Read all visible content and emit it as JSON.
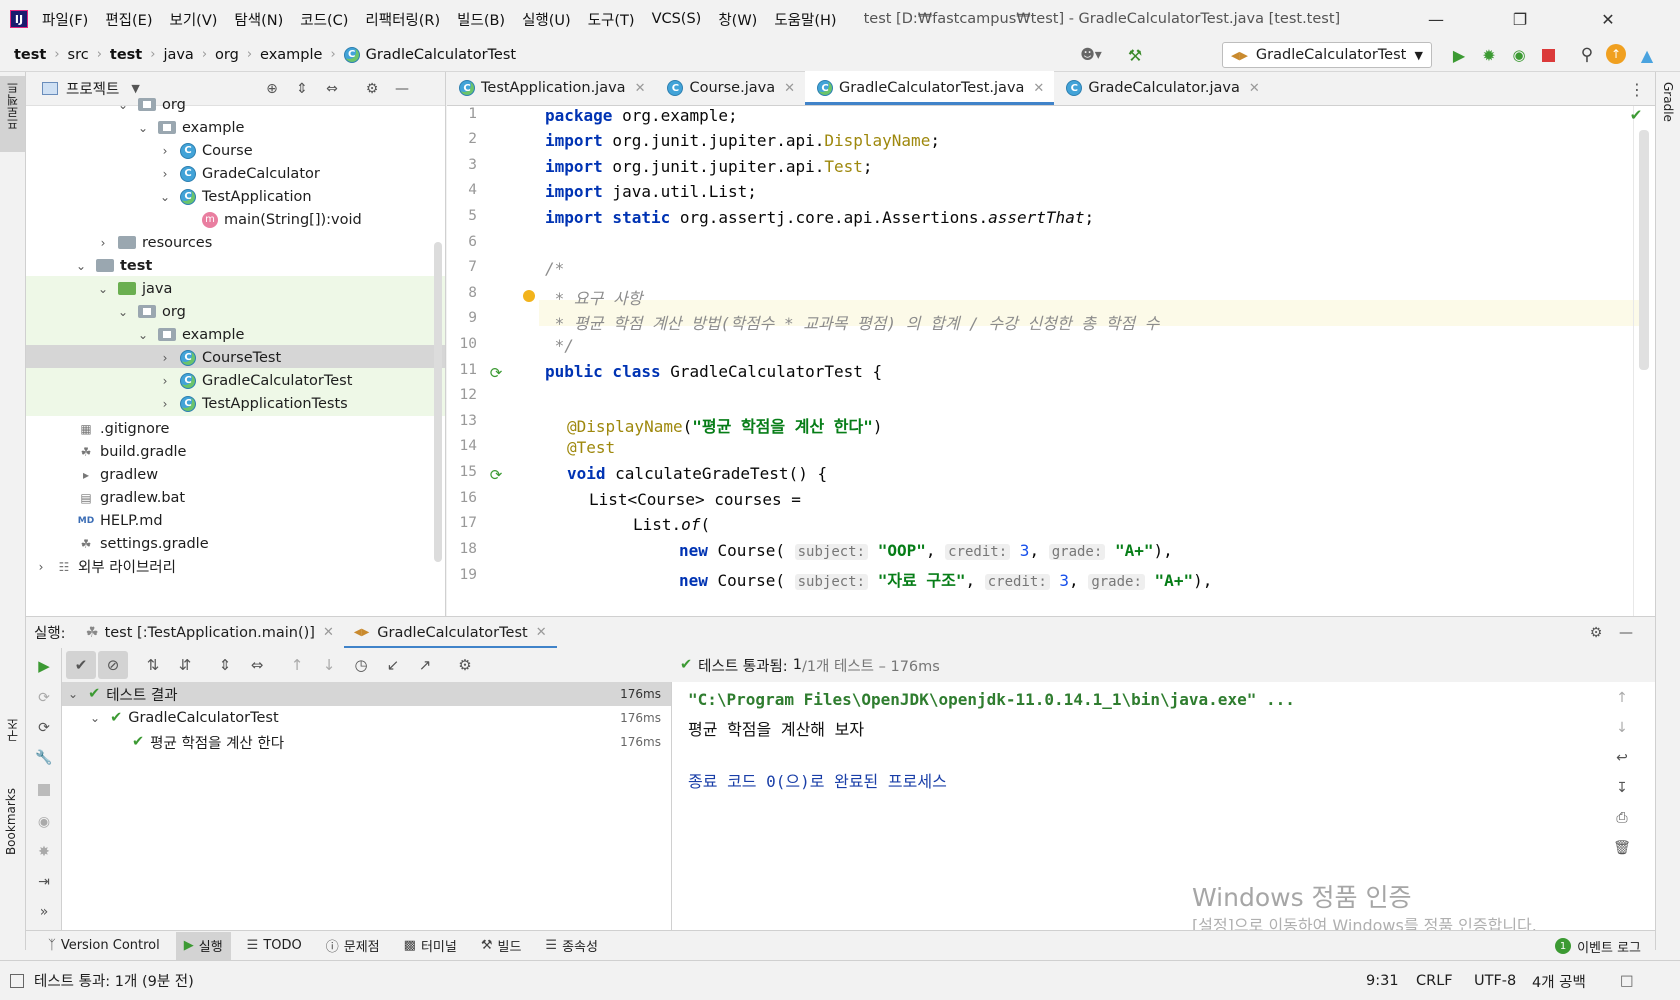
{
  "menu": {
    "items": [
      "파일(F)",
      "편집(E)",
      "보기(V)",
      "탐색(N)",
      "코드(C)",
      "리팩터링(R)",
      "빌드(B)",
      "실행(U)",
      "도구(T)",
      "VCS(S)",
      "창(W)",
      "도움말(H)"
    ],
    "window_title": "test [D:₩fastcampus₩test] - GradleCalculatorTest.java [test.test]"
  },
  "breadcrumb": [
    "test",
    "src",
    "test",
    "java",
    "org",
    "example",
    "GradleCalculatorTest"
  ],
  "run_config": "GradleCalculatorTest",
  "left_strip": {
    "project": "프로젝트",
    "structure": "구조",
    "bookmarks": "Bookmarks"
  },
  "right_strip": {
    "gradle": "Gradle"
  },
  "project": {
    "title": "프로젝트",
    "tree": [
      {
        "label": "org",
        "kind": "package"
      },
      {
        "label": "example",
        "kind": "package"
      },
      {
        "label": "Course",
        "kind": "class"
      },
      {
        "label": "GradeCalculator",
        "kind": "class"
      },
      {
        "label": "TestApplication",
        "kind": "class"
      },
      {
        "label": "main(String[]):void",
        "kind": "method"
      },
      {
        "label": "resources",
        "kind": "folder"
      },
      {
        "label": "test",
        "kind": "folder"
      },
      {
        "label": "java",
        "kind": "folder"
      },
      {
        "label": "org",
        "kind": "package"
      },
      {
        "label": "example",
        "kind": "package"
      },
      {
        "label": "CourseTest",
        "kind": "test-class"
      },
      {
        "label": "GradleCalculatorTest",
        "kind": "test-class"
      },
      {
        "label": "TestApplicationTests",
        "kind": "test-class"
      },
      {
        "label": ".gitignore",
        "kind": "file"
      },
      {
        "label": "build.gradle",
        "kind": "file"
      },
      {
        "label": "gradlew",
        "kind": "file"
      },
      {
        "label": "gradlew.bat",
        "kind": "file"
      },
      {
        "label": "HELP.md",
        "kind": "file"
      },
      {
        "label": "settings.gradle",
        "kind": "file"
      },
      {
        "label": "외부 라이브러리",
        "kind": "library"
      }
    ]
  },
  "editor": {
    "tabs": [
      "TestApplication.java",
      "Course.java",
      "GradleCalculatorTest.java",
      "GradeCalculator.java"
    ],
    "active_tab": "GradleCalculatorTest.java",
    "line_numbers": [
      "1",
      "2",
      "3",
      "4",
      "5",
      "6",
      "7",
      "8",
      "9",
      "10",
      "11",
      "12",
      "13",
      "14",
      "15",
      "16",
      "17",
      "18",
      "19"
    ],
    "code": {
      "l1_kw": "package",
      "l1_rest": " org.example;",
      "l2_kw": "import",
      "l2_rest": " org.junit.jupiter.api.",
      "l2_ann": "DisplayName",
      "l2_end": ";",
      "l3_kw": "import",
      "l3_rest": " org.junit.jupiter.api.",
      "l3_ann": "Test",
      "l3_end": ";",
      "l4_kw": "import",
      "l4_rest": " java.util.List;",
      "l5_kw": "import static",
      "l5_rest": " org.assertj.core.api.Assertions.",
      "l5_it": "assertThat",
      "l5_end": ";",
      "l7": "/*",
      "l8": " * 요구 사항",
      "l9": " * 평균 학점 계산 방법(학점수 * 교과목 평점) 의 합계 / 수강 신청한 총 학점 수",
      "l10": " */",
      "l11_kw": "public class",
      "l11_rest": " GradleCalculatorTest {",
      "l13_ann": "@DisplayName",
      "l13_p1": "(",
      "l13_str": "\"평균 학점을 계산 한다\"",
      "l13_p2": ")",
      "l14_ann": "@Test",
      "l15_kw": "void",
      "l15_rest": " calculateGradeTest() {",
      "l16": "List<Course> courses =",
      "l17_a": "List.",
      "l17_it": "of",
      "l17_b": "(",
      "l18_kw": "new",
      "l18_a": " Course(",
      "l18_h1": "subject:",
      "l18_s1": "\"OOP\"",
      "l18_c1": ",",
      "l18_h2": "credit:",
      "l18_n": "3",
      "l18_c2": ",",
      "l18_h3": "grade:",
      "l18_s2": "\"A+\"",
      "l18_end": "),",
      "l19_kw": "new",
      "l19_a": " Course(",
      "l19_h1": "subject:",
      "l19_s1": "\"자료 구조\"",
      "l19_c1": ",",
      "l19_h2": "credit:",
      "l19_n": "3",
      "l19_c2": ",",
      "l19_h3": "grade:",
      "l19_s2": "\"A+\"",
      "l19_end": "),"
    }
  },
  "run": {
    "label": "실행:",
    "tabs": [
      "test [:TestApplication.main()]",
      "GradleCalculatorTest"
    ],
    "status_pass": "테스트 통과됨:",
    "status_count": "1",
    "status_rest": "/1개 테스트 – 176ms",
    "tree": [
      {
        "label": "테스트 결과",
        "time": "176ms"
      },
      {
        "label": "GradleCalculatorTest",
        "time": "176ms"
      },
      {
        "label": "평균 학점을 계산 한다",
        "time": "176ms"
      }
    ],
    "console": [
      "\"C:\\Program Files\\OpenJDK\\openjdk-11.0.14.1_1\\bin\\java.exe\" ...",
      "평균 학점을 계산해 보자",
      "",
      "종료 코드 0(으)로 완료된 프로세스"
    ]
  },
  "watermark": {
    "title": "Windows 정품 인증",
    "subtitle": "[설정]으로 이동하여 Windows를 정품 인증합니다."
  },
  "tool_tabs": [
    "Version Control",
    "실행",
    "TODO",
    "문제점",
    "터미널",
    "빌드",
    "종속성"
  ],
  "event_log": "이벤트 로그",
  "event_count": "1",
  "status": {
    "message": "테스트 통과: 1개 (9분 전)",
    "position": "9:31",
    "line_sep": "CRLF",
    "encoding": "UTF-8",
    "indent": "4개 공백"
  }
}
